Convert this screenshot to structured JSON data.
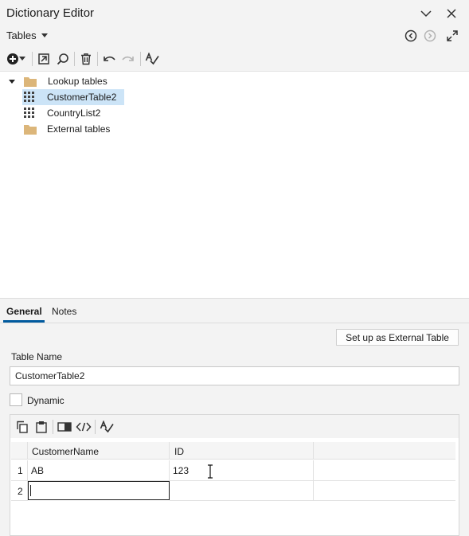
{
  "window": {
    "title": "Dictionary Editor",
    "icons": [
      "chevron-down-icon",
      "close-icon"
    ]
  },
  "subbar": {
    "dropdown_label": "Tables",
    "icons": [
      "back-circle-icon",
      "forward-circle-icon",
      "expand-icon"
    ]
  },
  "toolbar": {
    "icons": [
      "add-icon",
      "add-dropdown-icon",
      "go-to-icon",
      "search-icon",
      "delete-icon",
      "undo-icon",
      "redo-icon",
      "spell-check-icon"
    ]
  },
  "tree": {
    "items": [
      {
        "label": "Lookup tables",
        "icon": "folder-icon",
        "expanded": true
      },
      {
        "label": "CustomerTable2",
        "icon": "table-icon",
        "selected": true
      },
      {
        "label": "CountryList2",
        "icon": "table-icon"
      },
      {
        "label": "External tables",
        "icon": "folder-icon"
      }
    ]
  },
  "tabs": [
    {
      "label": "General",
      "active": true
    },
    {
      "label": "Notes",
      "active": false
    }
  ],
  "general": {
    "external_button": "Set up as External Table",
    "table_name_label": "Table Name",
    "table_name_value": "CustomerTable2",
    "dynamic_label": "Dynamic",
    "dynamic_checked": false
  },
  "grid": {
    "toolbar_icons": [
      "copy-icon",
      "paste-icon",
      "insert-column-icon",
      "code-icon",
      "spell-check-icon"
    ],
    "headers": [
      "CustomerName",
      "ID"
    ],
    "rows": [
      {
        "num": "1",
        "CustomerName": "AB",
        "ID": "123"
      },
      {
        "num": "2",
        "CustomerName": "",
        "ID": ""
      }
    ]
  },
  "colors": {
    "selection": "#cce4f7",
    "accent": "#005a9e",
    "folder": "#dcb67a"
  }
}
